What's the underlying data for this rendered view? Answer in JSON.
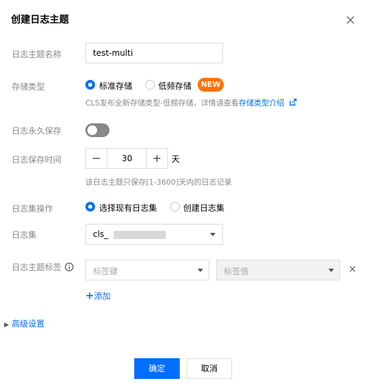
{
  "dialog": {
    "title": "创建日志主题"
  },
  "labels": {
    "topic_name": "日志主题名称",
    "storage_type": "存储类型",
    "permanent": "日志永久保存",
    "retention": "日志保存时间",
    "logset_op": "日志集操作",
    "logset": "日志集",
    "topic_tag": "日志主题标签"
  },
  "topic_name": {
    "value": "test-multi"
  },
  "storage": {
    "options": [
      "标准存储",
      "低频存储"
    ],
    "selected": "标准存储",
    "badge": "NEW",
    "hint_prefix": "CLS发布全新存储类型-低频存储，详情请查看",
    "hint_link": "存储类型介绍"
  },
  "permanent": {
    "enabled": false
  },
  "retention": {
    "minus": "−",
    "plus": "+",
    "value": "30",
    "unit": "天",
    "hint": "该日志主题只保存[1-3600]天内的日志记录"
  },
  "logset_op": {
    "options": [
      "选择现有日志集",
      "创建日志集"
    ],
    "selected": "选择现有日志集"
  },
  "logset": {
    "value": "cls_"
  },
  "tags": {
    "key_placeholder": "标签键",
    "value_placeholder": "标签值",
    "remove": "×",
    "add_label": "添加"
  },
  "advanced": {
    "label": "高级设置"
  },
  "footer": {
    "confirm": "确定",
    "cancel": "取消"
  },
  "colors": {
    "primary": "#006eff",
    "badge": "#ff7200",
    "label": "#888888"
  }
}
